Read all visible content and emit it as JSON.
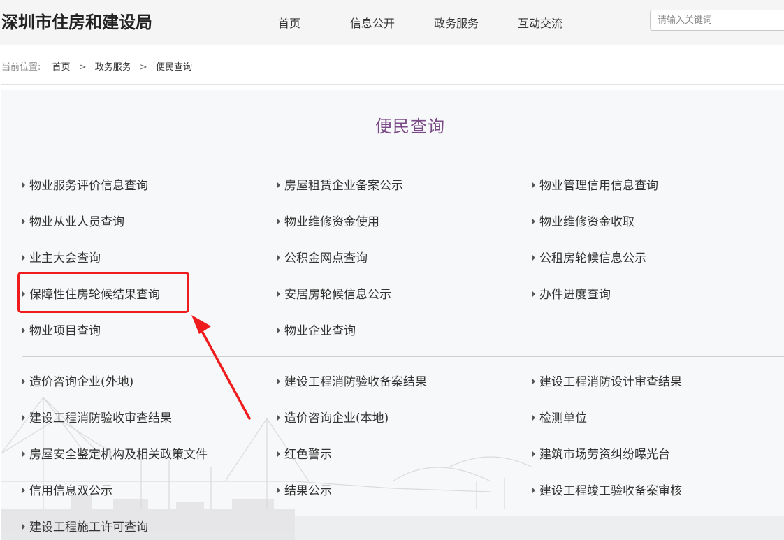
{
  "header": {
    "site_title": "深圳市住房和建设局",
    "nav": [
      "首页",
      "信息公开",
      "政务服务",
      "互动交流"
    ],
    "search_placeholder": "请输入关键词"
  },
  "breadcrumb": {
    "prefix": "当前位置:",
    "items": [
      "首页",
      "政务服务",
      "便民查询"
    ],
    "separator": ">"
  },
  "page": {
    "title": "便民查询"
  },
  "links": {
    "group1": [
      [
        "物业服务评价信息查询",
        "房屋租赁企业备案公示",
        "物业管理信用信息查询"
      ],
      [
        "物业从业人员查询",
        "物业维修资金使用",
        "物业维修资金收取"
      ],
      [
        "业主大会查询",
        "公积金网点查询",
        "公租房轮候信息公示"
      ],
      [
        "保障性住房轮候结果查询",
        "安居房轮候信息公示",
        "办件进度查询"
      ],
      [
        "物业项目查询",
        "物业企业查询"
      ]
    ],
    "group2": [
      [
        "造价咨询企业(外地)",
        "建设工程消防验收备案结果",
        "建设工程消防设计审查结果"
      ],
      [
        "建设工程消防验收审查结果",
        "造价咨询企业(本地)",
        "检测单位"
      ],
      [
        "房屋安全鉴定机构及相关政策文件",
        "红色警示",
        "建筑市场劳资纠纷曝光台"
      ],
      [
        "信用信息双公示",
        "结果公示",
        "建设工程竣工验收备案审核"
      ],
      [
        "建设工程施工许可查询"
      ]
    ]
  },
  "annotation": {
    "highlight_color": "#ee1c1c"
  },
  "colors": {
    "title_purple": "#7a4a86",
    "header_bg": "#f5f5f5",
    "panel_bg": "#f7f8f9"
  }
}
